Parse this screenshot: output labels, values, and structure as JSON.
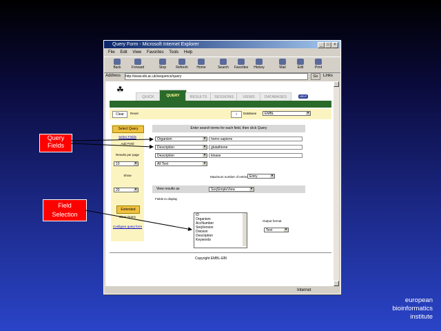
{
  "window": {
    "title": "Query Form - Microsoft Internet Explorer",
    "menu": [
      "File",
      "Edit",
      "View",
      "Favorites",
      "Tools",
      "Help"
    ],
    "toolbar": [
      "Back",
      "Forward",
      "Stop",
      "Refresh",
      "Home",
      "Search",
      "Favorites",
      "History",
      "Mail",
      "Edit",
      "Print"
    ],
    "address_label": "Address",
    "address": "http://www.ebi.ac.uk/sequence/query",
    "go_label": "Go",
    "links_label": "Links",
    "status_right": "Internet"
  },
  "page": {
    "tabs": [
      "QUICK",
      "QUERY",
      "RESULTS",
      "SESSIONS",
      "VIEWS",
      "DATABASES"
    ],
    "active_tab": "QUERY",
    "help_label": "HELP",
    "clear_button": "Clear",
    "reset_label": "Reset",
    "db_label": "Database",
    "db_value": "EMBL",
    "left": {
      "select_query_button": "Select Query",
      "select_fields_link": "Select Fields",
      "add_field_label": "Add Field",
      "results_per_page": "Results per page",
      "results_value": "10",
      "show_label": "Show",
      "show_value": "20",
      "extended_button": "Extended",
      "clear_query": "Clear Query",
      "configure_link": "Configure query form"
    },
    "main": {
      "header": "Enter search terms for each field, then click Query",
      "rows": [
        {
          "field": "Organism",
          "value": "homo sapiens"
        },
        {
          "field": "Description",
          "value": "glutathione"
        },
        {
          "field": "Description",
          "value": "kinase"
        },
        {
          "field": "All Text",
          "value": ""
        }
      ],
      "limit_label": "Maximum number of entries",
      "limit_value": "Entry",
      "output_header": "View results as",
      "output_value": "SeqSimpleView",
      "fields_label": "Fields to display",
      "list_items": [
        "ID",
        "Organism",
        "AccNumber",
        "SeqVersion",
        "Division",
        "Description",
        "Keywords"
      ],
      "format_label": "Output format",
      "format_value": "Text"
    },
    "footer": "Copyright EMBL-EBI"
  },
  "annotations": {
    "query_fields": "Query\nFields",
    "field_selection": "Field\nSelection"
  },
  "branding": {
    "line1": "european",
    "line2": "bioinformatics",
    "line3": "institute"
  }
}
